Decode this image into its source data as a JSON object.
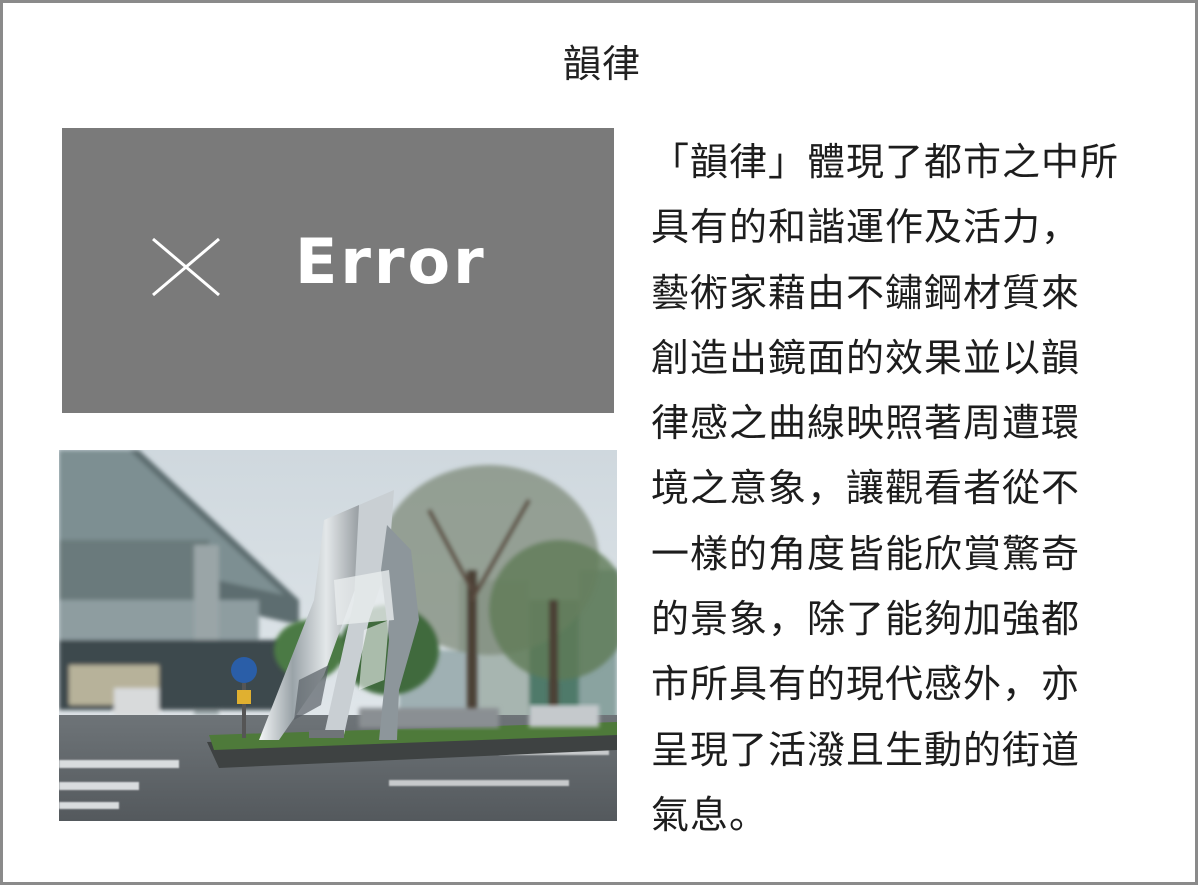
{
  "page": {
    "title": "韻律"
  },
  "error_placeholder": {
    "icon": "close-icon",
    "label": "Error",
    "background": "#7a7a7a"
  },
  "photo": {
    "subject": "sculpture-photo"
  },
  "description": {
    "lines": [
      "「韻律」體現了都市之中所",
      "具有的和諧運作及活力，",
      "藝術家藉由不鏽鋼材質來",
      "創造出鏡面的效果並以韻",
      "律感之曲線映照著周遭環",
      "境之意象，讓觀看者從不",
      "一樣的角度皆能欣賞驚奇",
      "的景象，除了能夠加強都",
      "市所具有的現代感外，亦",
      "呈現了活潑且生動的街道",
      "氣息。"
    ]
  },
  "colors": {
    "frame_border": "#8a8a8a",
    "text": "#1d1d1d"
  }
}
